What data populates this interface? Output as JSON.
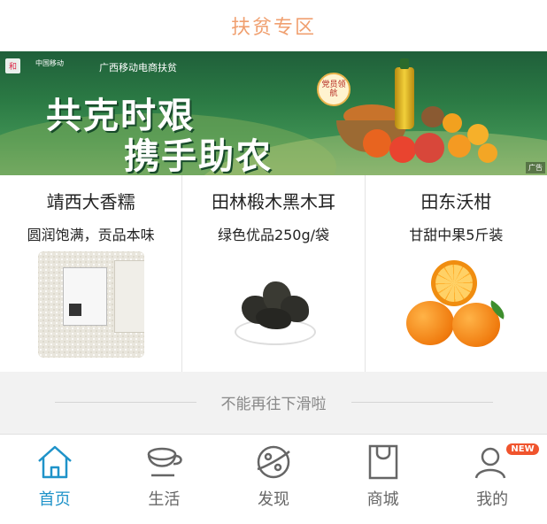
{
  "header": {
    "title": "扶贫专区"
  },
  "banner": {
    "brand_left": "和",
    "brand_right": "中国移动",
    "subtitle": "广西移动电商扶贫",
    "headline_line1": "共克时艰",
    "headline_line2": "携手助农",
    "badge_text": "党员领航",
    "ad_label": "广告"
  },
  "products": [
    {
      "name": "靖西大香糯",
      "desc": "圆润饱满，贡品本味",
      "image": "rice-bags"
    },
    {
      "name": "田林椴木黑木耳",
      "desc": "绿色优品250g/袋",
      "image": "black-fungus"
    },
    {
      "name": "田东沃柑",
      "desc": "甘甜中果5斤装",
      "image": "oranges"
    }
  ],
  "end_note": "不能再往下滑啦",
  "tabbar": {
    "active_color": "#1f93c9",
    "tabs": [
      {
        "label": "首页",
        "icon": "home-icon",
        "active": true
      },
      {
        "label": "生活",
        "icon": "cup-icon",
        "active": false
      },
      {
        "label": "发现",
        "icon": "planet-icon",
        "active": false
      },
      {
        "label": "商城",
        "icon": "shopping-bag-icon",
        "active": false
      },
      {
        "label": "我的",
        "icon": "user-icon",
        "active": false,
        "badge": "NEW"
      }
    ]
  }
}
